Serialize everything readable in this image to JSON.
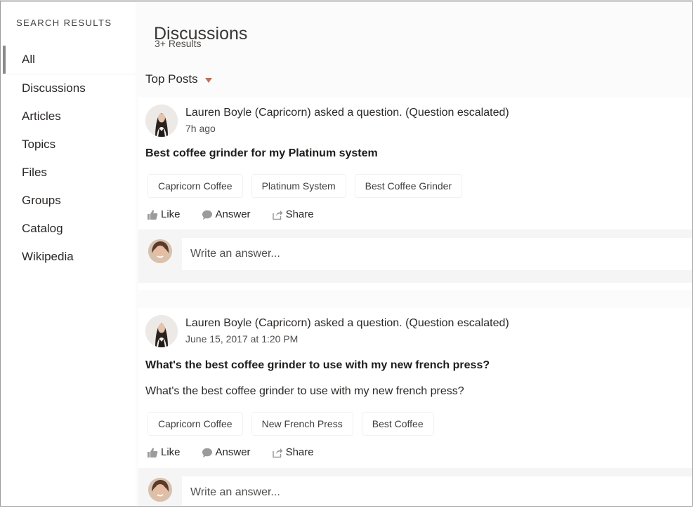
{
  "sidebar": {
    "heading": "SEARCH RESULTS",
    "items": [
      {
        "label": "All",
        "active": true
      },
      {
        "label": "Discussions"
      },
      {
        "label": "Articles"
      },
      {
        "label": "Topics"
      },
      {
        "label": "Files"
      },
      {
        "label": "Groups"
      },
      {
        "label": "Catalog"
      },
      {
        "label": "Wikipedia"
      }
    ]
  },
  "main": {
    "title": "Discussions",
    "results_count": "3+ Results",
    "sort_label": "Top Posts"
  },
  "posts": [
    {
      "author_line": "Lauren Boyle (Capricorn) asked a question. (Question escalated)",
      "timestamp": "7h ago",
      "title": "Best coffee grinder for my Platinum system",
      "body": "",
      "tags": [
        "Capricorn Coffee",
        "Platinum System",
        "Best Coffee Grinder"
      ],
      "actions": {
        "like": "Like",
        "answer": "Answer",
        "share": "Share"
      },
      "answer_placeholder": "Write an answer..."
    },
    {
      "author_line": "Lauren Boyle (Capricorn) asked a question. (Question escalated)",
      "timestamp": "June 15, 2017 at 1:20 PM",
      "title": "What's the best coffee grinder to use with my new french press?",
      "body": "What's the best coffee grinder to use with my new french press?",
      "tags": [
        "Capricorn Coffee",
        "New French Press",
        "Best Coffee"
      ],
      "actions": {
        "like": "Like",
        "answer": "Answer",
        "share": "Share"
      },
      "answer_placeholder": "Write an answer..."
    }
  ],
  "colors": {
    "accent_caret": "#c0705a",
    "active_indicator": "#8a8a8a",
    "main_background": "#fbfbfb",
    "answer_area": "#f5f5f5"
  },
  "icons": {
    "like": "thumbs-up-icon",
    "answer": "speech-bubble-icon",
    "share": "share-icon",
    "sort": "caret-down-icon"
  }
}
